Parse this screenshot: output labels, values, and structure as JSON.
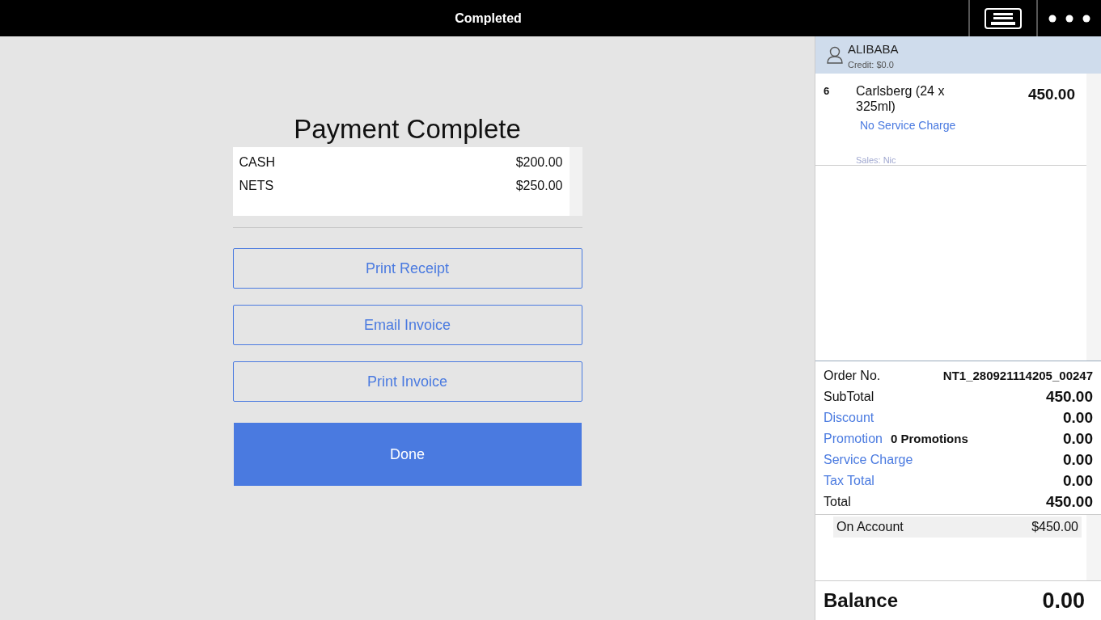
{
  "top_bar": {
    "title": "Completed"
  },
  "payment": {
    "title": "Payment Complete",
    "tenders": [
      {
        "method": "CASH",
        "amount": "$200.00"
      },
      {
        "method": "NETS",
        "amount": "$250.00"
      }
    ],
    "actions": [
      "Print Receipt",
      "Email Invoice",
      "Print Invoice"
    ],
    "done": "Done"
  },
  "customer": {
    "name": "ALIBABA",
    "credit": "Credit: $0.0"
  },
  "items": [
    {
      "qty": "6",
      "name": "Carlsberg (24 x 325ml)",
      "price": "450.00",
      "note": "No Service Charge",
      "sales": "Sales: Nic"
    }
  ],
  "totals": [
    {
      "kind": "order",
      "label": "Order No.",
      "value": "NT1_280921114205_00247"
    },
    {
      "kind": "plain",
      "label": "SubTotal",
      "value": "450.00"
    },
    {
      "kind": "link",
      "label": "Discount",
      "value": "0.00"
    },
    {
      "kind": "link",
      "label": "Promotion",
      "extra": "0 Promotions",
      "value": "0.00"
    },
    {
      "kind": "link",
      "label": "Service Charge",
      "value": "0.00"
    },
    {
      "kind": "link",
      "label": "Tax Total",
      "value": "0.00"
    },
    {
      "kind": "plain",
      "label": "Total",
      "value": "450.00"
    }
  ],
  "payments": [
    {
      "method": "On Account",
      "amount": "$450.00"
    }
  ],
  "balance": {
    "label": "Balance",
    "value": "0.00"
  }
}
